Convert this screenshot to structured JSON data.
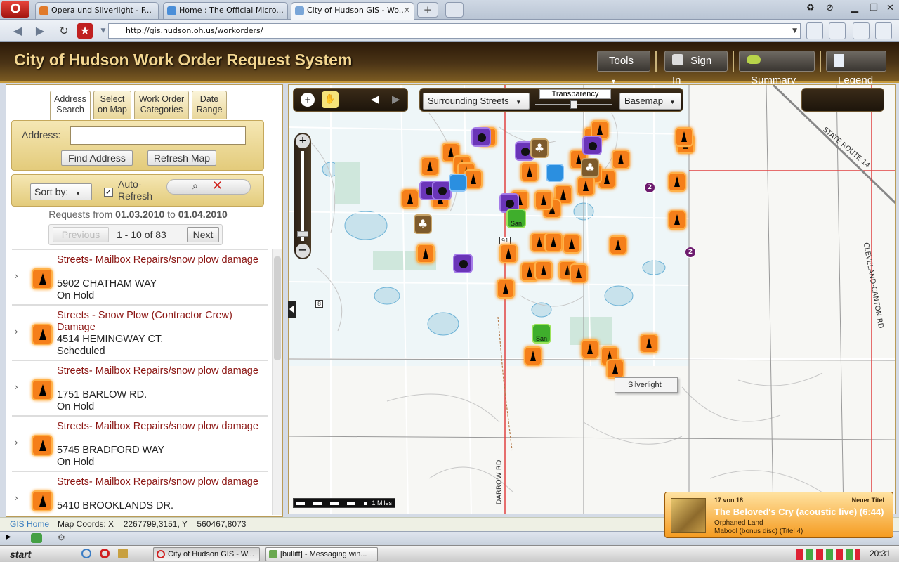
{
  "browser": {
    "opera_logo": "O",
    "tabs": [
      {
        "label": "Opera und Silverlight - F..."
      },
      {
        "label": "Home : The Official Micro..."
      },
      {
        "label": "City of Hudson GIS - Wo..."
      }
    ],
    "url": "http://gis.hudson.oh.us/workorders/"
  },
  "app": {
    "title": "City of Hudson Work Order Request System",
    "buttons": {
      "tools": "Tools",
      "sign_in": "Sign In",
      "summary": "Summary",
      "legend": "Legend"
    }
  },
  "left": {
    "tabs": [
      "Address Search",
      "Select on Map",
      "Work Order Categories",
      "Date Range"
    ],
    "address_label": "Address:",
    "find_button": "Find Address",
    "refresh_button": "Refresh Map",
    "sort_label": "Sort by:",
    "auto_refresh": "Auto-Refresh",
    "range_prefix": "Requests from",
    "range_from": "01.03.2010",
    "range_to_word": "to",
    "range_to": "01.04.2010",
    "pager": {
      "previous": "Previous",
      "status": "1 - 10 of 83",
      "next": "Next"
    },
    "items": [
      {
        "category": "Streets- Mailbox Repairs/snow plow damage",
        "address": "5902 CHATHAM WAY",
        "status": "On Hold"
      },
      {
        "category": "Streets - Snow Plow (Contractor Crew) Damage",
        "address": "4514 HEMINGWAY CT.",
        "status": "Scheduled"
      },
      {
        "category": "Streets- Mailbox Repairs/snow plow damage",
        "address": "1751 BARLOW RD.",
        "status": "On Hold"
      },
      {
        "category": "Streets- Mailbox Repairs/snow plow damage",
        "address": "5745 BRADFORD WAY",
        "status": "On Hold"
      },
      {
        "category": "Streets- Mailbox Repairs/snow plow damage",
        "address": "5410 BROOKLANDS DR.",
        "status": ""
      }
    ]
  },
  "map": {
    "layer_dropdown": "Surrounding Streets",
    "transparency_label": "Transparency",
    "basemap_dropdown": "Basemap",
    "tooltip": "Silverlight",
    "scale_label": "1 Miles",
    "green_marker_label": "San",
    "cluster_count": "2",
    "route_labels": {
      "r91": "91",
      "r8": "8",
      "state_route": "STATE ROUTE 14",
      "darrow": "DARROW RD",
      "cleveland": "CLEVELAND-CANTON RD"
    }
  },
  "status": {
    "gis_home": "GIS Home",
    "coords": "Map Coords: X = 2267799,3151, Y = 560467,8073"
  },
  "taskbar": {
    "start": "start",
    "tasks": [
      "City of Hudson GIS - W...",
      "[bullitt] - Messaging win..."
    ],
    "clock": "20:31"
  },
  "popup": {
    "counter": "17 von 18",
    "badge": "Neuer Titel",
    "title": "The Beloved's Cry (acoustic live) (6:44)",
    "artist": "Orphaned Land",
    "album": "Mabool (bonus disc) (Titel 4)"
  },
  "markers": {
    "orange": [
      [
        270,
        60
      ],
      [
        218,
        82
      ],
      [
        188,
        102
      ],
      [
        234,
        100
      ],
      [
        330,
        110
      ],
      [
        460,
        92
      ],
      [
        540,
        124
      ],
      [
        552,
        70
      ],
      [
        400,
        92
      ],
      [
        378,
        142
      ],
      [
        160,
        148
      ],
      [
        203,
        148
      ],
      [
        362,
        162
      ],
      [
        300,
        226
      ],
      [
        344,
        210
      ],
      [
        364,
        210
      ],
      [
        390,
        212
      ],
      [
        456,
        214
      ],
      [
        182,
        226
      ],
      [
        384,
        250
      ],
      [
        330,
        252
      ],
      [
        350,
        250
      ],
      [
        400,
        254
      ],
      [
        296,
        276
      ],
      [
        335,
        372
      ],
      [
        416,
        362
      ],
      [
        444,
        372
      ],
      [
        500,
        354
      ],
      [
        452,
        390
      ],
      [
        540,
        178
      ],
      [
        550,
        60
      ],
      [
        440,
        120
      ],
      [
        420,
        112
      ],
      [
        410,
        130
      ],
      [
        316,
        150
      ],
      [
        350,
        150
      ],
      [
        420,
        60
      ],
      [
        430,
        50
      ],
      [
        240,
        110
      ],
      [
        250,
        120
      ]
    ],
    "purple": [
      [
        260,
        60
      ],
      [
        322,
        80
      ],
      [
        418,
        72
      ],
      [
        186,
        136
      ],
      [
        204,
        136
      ],
      [
        300,
        154
      ],
      [
        234,
        240
      ]
    ],
    "brown": [
      [
        344,
        76
      ],
      [
        416,
        104
      ],
      [
        178,
        184
      ]
    ],
    "green": [
      [
        310,
        176
      ],
      [
        346,
        340
      ]
    ],
    "blue": [
      [
        366,
        112
      ],
      [
        228,
        126
      ]
    ],
    "clusters": [
      [
        506,
        138
      ],
      [
        564,
        230
      ]
    ]
  }
}
